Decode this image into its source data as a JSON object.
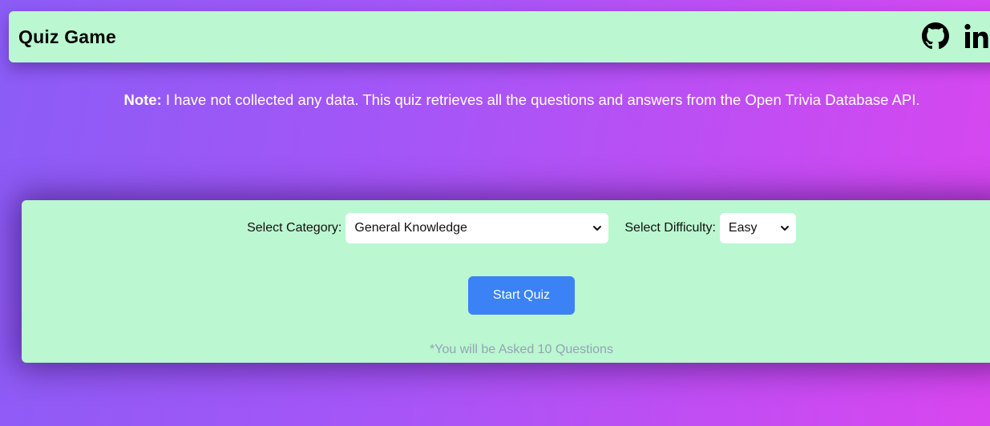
{
  "header": {
    "title": "Quiz Game",
    "icons": [
      "github-icon",
      "linkedin-icon"
    ]
  },
  "note": {
    "label": "Note:",
    "text": " I have not collected any data. This quiz retrieves all the questions and answers from the Open Trivia Database API."
  },
  "form": {
    "category_label": "Select Category:",
    "category_value": "General Knowledge",
    "difficulty_label": "Select Difficulty:",
    "difficulty_value": "Easy",
    "start_label": "Start Quiz",
    "hint": "*You will be Asked 10 Questions"
  },
  "colors": {
    "panel": "#bbf7d0",
    "button": "#3b82f6",
    "background_start": "#8b5cf6",
    "background_end": "#d946ef"
  }
}
